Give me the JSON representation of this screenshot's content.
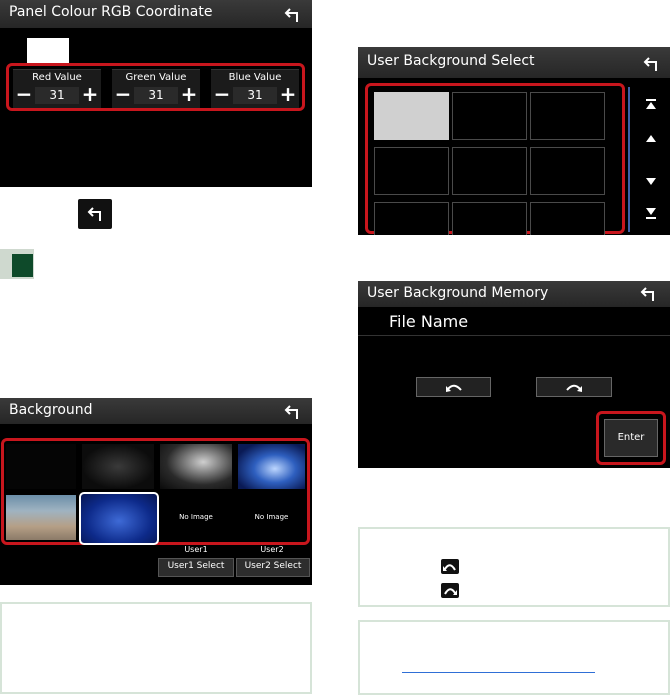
{
  "panel_colour": {
    "title": "Panel Colour RGB Coordinate",
    "controls": [
      {
        "label": "Red Value",
        "value": "31"
      },
      {
        "label": "Green Value",
        "value": "31"
      },
      {
        "label": "Blue Value",
        "value": "31"
      }
    ],
    "minus_glyph": "−",
    "plus_glyph": "+"
  },
  "background": {
    "title": "Background",
    "slots": [
      "No Image",
      "No Image"
    ],
    "user_labels": [
      "User1",
      "User2"
    ],
    "buttons": [
      "User1 Select",
      "User2 Select"
    ]
  },
  "user_bg_select": {
    "title": "User Background Select"
  },
  "user_bg_memory": {
    "title": "User Background Memory",
    "file_name_label": "File Name",
    "enter_label": "Enter"
  },
  "icons": {
    "back": "back-arrow-icon",
    "top": "scroll-top-icon",
    "up": "scroll-up-icon",
    "down": "scroll-down-icon",
    "bottom": "scroll-bottom-icon",
    "rotate_left": "rotate-left-icon",
    "rotate_right": "rotate-right-icon"
  }
}
